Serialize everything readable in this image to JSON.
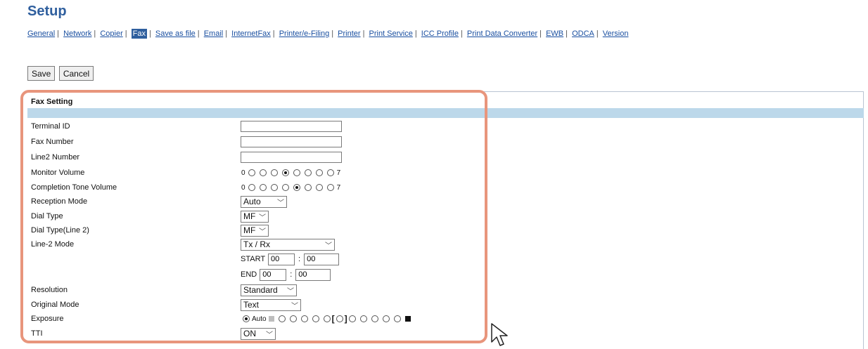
{
  "page": {
    "title": "Setup",
    "nav": [
      {
        "label": "General"
      },
      {
        "label": "Network"
      },
      {
        "label": "Copier"
      },
      {
        "label": "Fax",
        "active": true
      },
      {
        "label": "Save as file"
      },
      {
        "label": "Email"
      },
      {
        "label": "InternetFax"
      },
      {
        "label": "Printer/e-Filing"
      },
      {
        "label": "Printer"
      },
      {
        "label": "Print Service"
      },
      {
        "label": "ICC Profile"
      },
      {
        "label": "Print Data Converter"
      },
      {
        "label": "EWB"
      },
      {
        "label": "ODCA"
      },
      {
        "label": "Version"
      }
    ],
    "nav_separator": "|",
    "buttons": {
      "save": "Save",
      "cancel": "Cancel"
    }
  },
  "fax_setting": {
    "section_title": "Fax Setting",
    "terminal_id": {
      "label": "Terminal ID",
      "value": ""
    },
    "fax_number": {
      "label": "Fax Number",
      "value": ""
    },
    "line2_number": {
      "label": "Line2 Number",
      "value": ""
    },
    "monitor_volume": {
      "label": "Monitor Volume",
      "min": "0",
      "max": "7",
      "options": 8,
      "selected": 3
    },
    "completion_tone_volume": {
      "label": "Completion Tone Volume",
      "min": "0",
      "max": "7",
      "options": 8,
      "selected": 4
    },
    "reception_mode": {
      "label": "Reception Mode",
      "value": "Auto"
    },
    "dial_type": {
      "label": "Dial Type",
      "value": "MF"
    },
    "dial_type_line2": {
      "label": "Dial Type(Line 2)",
      "value": "MF"
    },
    "line2_mode": {
      "label": "Line-2 Mode",
      "value": "Tx / Rx",
      "start_label": "START",
      "end_label": "END",
      "start_hour": "00",
      "start_min": "00",
      "end_hour": "00",
      "end_min": "00",
      "colon": ":"
    },
    "resolution": {
      "label": "Resolution",
      "value": "Standard"
    },
    "original_mode": {
      "label": "Original Mode",
      "value": "Text"
    },
    "exposure": {
      "label": "Exposure",
      "auto_label": "Auto",
      "selected": "auto"
    },
    "tti": {
      "label": "TTI",
      "value": "ON"
    }
  },
  "colors": {
    "title": "#2f5f9e",
    "link": "#1a4fa0",
    "active_tab": "#2f5f9e",
    "band": "#bcd8ea",
    "highlight": "#e8957c"
  },
  "icons": {
    "chevron": "chevron-down-icon",
    "cursor": "mouse-pointer-icon"
  }
}
